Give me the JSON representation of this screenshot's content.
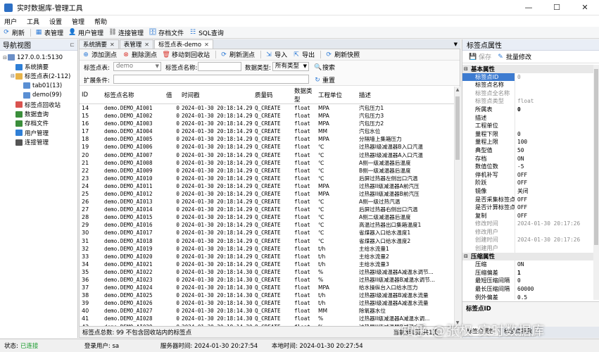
{
  "window": {
    "title": "实时数据库-管理工具",
    "controls": [
      "—",
      "☐",
      "✕"
    ]
  },
  "menu": [
    "用户",
    "工具",
    "设置",
    "管理",
    "帮助"
  ],
  "toolbar": [
    {
      "label": "刷新",
      "icon": "refresh-icon"
    },
    {
      "label": "表管理",
      "icon": "table-icon"
    },
    {
      "label": "用户管理",
      "icon": "user-icon"
    },
    {
      "label": "连接管理",
      "icon": "connection-icon"
    },
    {
      "label": "存档文件",
      "icon": "archive-icon"
    },
    {
      "label": "SQL查询",
      "icon": "sql-icon"
    }
  ],
  "nav": {
    "title": "导航视图",
    "items": [
      {
        "label": "127.0.0.1:5130",
        "indent": 0,
        "twisty": "⊟",
        "icon": "server-icon",
        "color": "#6b8fc7"
      },
      {
        "label": "系统摘要",
        "indent": 1,
        "twisty": "",
        "icon": "summary-icon",
        "color": "#2f7fd6"
      },
      {
        "label": "标签点表(2-112)",
        "indent": 1,
        "twisty": "⊟",
        "icon": "folder-icon",
        "color": "#e8b44a"
      },
      {
        "label": "tab01(13)",
        "indent": 2,
        "twisty": "",
        "icon": "table-icon",
        "color": "#5a8fd3"
      },
      {
        "label": "demo(99)",
        "indent": 2,
        "twisty": "",
        "icon": "table-icon",
        "color": "#5a8fd3"
      },
      {
        "label": "标签点回收站",
        "indent": 1,
        "twisty": "",
        "icon": "recycle-icon",
        "color": "#d9534f"
      },
      {
        "label": "数据查询",
        "indent": 1,
        "twisty": "",
        "icon": "query-icon",
        "color": "#3b8e3b"
      },
      {
        "label": "存档文件",
        "indent": 1,
        "twisty": "",
        "icon": "archive-icon",
        "color": "#3b8e3b"
      },
      {
        "label": "用户管理",
        "indent": 1,
        "twisty": "",
        "icon": "user-icon",
        "color": "#2f7fd6"
      },
      {
        "label": "连接管理",
        "indent": 1,
        "twisty": "",
        "icon": "connection-icon",
        "color": "#555555"
      }
    ]
  },
  "tabs": [
    {
      "label": "系统摘要",
      "active": false
    },
    {
      "label": "表管理",
      "active": false
    },
    {
      "label": "标签点表-demo",
      "active": true
    }
  ],
  "inner_toolbar": [
    {
      "label": "添加测点",
      "icon": "add-icon",
      "color": "#2e7bd6"
    },
    {
      "label": "删除测点",
      "icon": "delete-icon",
      "color": "#d9342b"
    },
    {
      "label": "移动到回收站",
      "icon": "recycle-icon",
      "color": "#d9342b"
    },
    {
      "label": "刷新测点",
      "icon": "refresh-icon",
      "color": "#2e7bd6"
    },
    {
      "label": "导入",
      "icon": "import-icon",
      "color": "#2e7bd6"
    },
    {
      "label": "导出",
      "icon": "export-icon",
      "color": "#2e7bd6"
    },
    {
      "label": "刷新快照",
      "icon": "refresh-icon",
      "color": "#2e7bd6"
    }
  ],
  "filters": {
    "table_label": "标签点表:",
    "table_value": "demo",
    "name_label": "标签点名称:",
    "name_value": "",
    "type_label": "数据类型:",
    "type_value": "所有类型",
    "ext_label": "扩展条件:",
    "ext_value": "",
    "search": "搜索",
    "reset": "重置"
  },
  "grid": {
    "columns": [
      "ID",
      "标签点名称",
      "值",
      "时间戳",
      "质量码",
      "数据类型",
      "工程单位",
      "描述"
    ],
    "rows": [
      [
        "14",
        "demo.DEMO_AI001",
        "0",
        "2024-01-30 20:18:14.296",
        "Q_CREATE",
        "float",
        "MPA",
        "汽包压力1"
      ],
      [
        "15",
        "demo.DEMO_AI002",
        "0",
        "2024-01-30 20:18:14.296",
        "Q_CREATE",
        "float",
        "MPA",
        "汽包压力3"
      ],
      [
        "16",
        "demo.DEMO_AI003",
        "0",
        "2024-01-30 20:18:14.296",
        "Q_CREATE",
        "float",
        "MPA",
        "汽包压力2"
      ],
      [
        "17",
        "demo.DEMO_AI004",
        "0",
        "2024-01-30 20:18:14.296",
        "Q_CREATE",
        "float",
        "MM",
        "汽包水位"
      ],
      [
        "18",
        "demo.DEMO_AI005",
        "0",
        "2024-01-30 20:18:14.297",
        "Q_CREATE",
        "float",
        "MPA",
        "分隔墙上集箱压力"
      ],
      [
        "19",
        "demo.DEMO_AI006",
        "0",
        "2024-01-30 20:18:14.297",
        "Q_CREATE",
        "float",
        "℃",
        "过热器I级减温器B入口汽温"
      ],
      [
        "20",
        "demo.DEMO_AI007",
        "0",
        "2024-01-30 20:18:14.297",
        "Q_CREATE",
        "float",
        "℃",
        "过热器I级减温器A入口汽温"
      ],
      [
        "21",
        "demo.DEMO_AI008",
        "0",
        "2024-01-30 20:18:14.297",
        "Q_CREATE",
        "float",
        "℃",
        "A侧一级减温器后温度"
      ],
      [
        "22",
        "demo.DEMO_AI009",
        "0",
        "2024-01-30 20:18:14.297",
        "Q_CREATE",
        "float",
        "℃",
        "B侧一级减温器后温度"
      ],
      [
        "23",
        "demo.DEMO_AI010",
        "0",
        "2024-01-30 20:18:14.297",
        "Q_CREATE",
        "float",
        "℃",
        "后屏过热器左侧出口汽温"
      ],
      [
        "24",
        "demo.DEMO_AI011",
        "0",
        "2024-01-30 20:18:14.298",
        "Q_CREATE",
        "float",
        "MPA",
        "过热器II级减温器A前汽压"
      ],
      [
        "25",
        "demo.DEMO_AI012",
        "0",
        "2024-01-30 20:18:14.298",
        "Q_CREATE",
        "float",
        "MPA",
        "过热器II级减温器B前汽压"
      ],
      [
        "26",
        "demo.DEMO_AI013",
        "0",
        "2024-01-30 20:18:14.298",
        "Q_CREATE",
        "float",
        "℃",
        "A侧一级过热汽温"
      ],
      [
        "27",
        "demo.DEMO_AI014",
        "0",
        "2024-01-30 20:18:14.298",
        "Q_CREATE",
        "float",
        "℃",
        "后屏过热器右侧出口汽温"
      ],
      [
        "28",
        "demo.DEMO_AI015",
        "0",
        "2024-01-30 20:18:14.299",
        "Q_CREATE",
        "float",
        "℃",
        "A侧二级减温器后温度"
      ],
      [
        "29",
        "demo.DEMO_AI016",
        "0",
        "2024-01-30 20:18:14.299",
        "Q_CREATE",
        "float",
        "℃",
        "高温过热器出口集箱温度1"
      ],
      [
        "30",
        "demo.DEMO_AI017",
        "0",
        "2024-01-30 20:18:14.299",
        "Q_CREATE",
        "float",
        "℃",
        "省煤器入口给水温度1"
      ],
      [
        "31",
        "demo.DEMO_AI018",
        "0",
        "2024-01-30 20:18:14.299",
        "Q_CREATE",
        "float",
        "℃",
        "省煤器入口给水温度2"
      ],
      [
        "32",
        "demo.DEMO_AI019",
        "0",
        "2024-01-30 20:18:14.299",
        "Q_CREATE",
        "float",
        "t/h",
        "主给水流量1"
      ],
      [
        "33",
        "demo.DEMO_AI020",
        "0",
        "2024-01-30 20:18:14.299",
        "Q_CREATE",
        "float",
        "t/h",
        "主给水流量2"
      ],
      [
        "34",
        "demo.DEMO_AI021",
        "0",
        "2024-01-30 20:18:14.299",
        "Q_CREATE",
        "float",
        "t/h",
        "主给水流量3"
      ],
      [
        "35",
        "demo.DEMO_AI022",
        "0",
        "2024-01-30 20:18:14.300",
        "Q_CREATE",
        "float",
        "%",
        "过热器I级减温器A减温水调节..."
      ],
      [
        "36",
        "demo.DEMO_AI023",
        "0",
        "2024-01-30 20:18:14.300",
        "Q_CREATE",
        "float",
        "%",
        "过热器II级减温器B减温水调节..."
      ],
      [
        "37",
        "demo.DEMO_AI024",
        "0",
        "2024-01-30 20:18:14.300",
        "Q_CREATE",
        "float",
        "MPA",
        "给水操纵台入口给水压力"
      ],
      [
        "38",
        "demo.DEMO_AI025",
        "0",
        "2024-01-30 20:18:14.300",
        "Q_CREATE",
        "float",
        "t/h",
        "过热器I级减温器B减温水流量"
      ],
      [
        "39",
        "demo.DEMO_AI026",
        "0",
        "2024-01-30 20:18:14.300",
        "Q_CREATE",
        "float",
        "t/h",
        "过热器I级减温器A减温水流量"
      ],
      [
        "40",
        "demo.DEMO_AI027",
        "0",
        "2024-01-30 20:18:14.300",
        "Q_CREATE",
        "float",
        "MM",
        "除氧器水位"
      ],
      [
        "41",
        "demo.DEMO_AI028",
        "0",
        "2024-01-30 20:18:14.301",
        "Q_CREATE",
        "float",
        "%",
        "过热器II级减温器A减温水调..."
      ],
      [
        "42",
        "demo.DEMO_AI029",
        "0",
        "2024-01-30 20:18:14.301",
        "Q_CREATE",
        "float",
        "%",
        "过热器II级减温器B减温水调..."
      ],
      [
        "43",
        "demo.DEMO_AI030",
        "0",
        "2024-01-30 20:18:14.301",
        "Q_CREATE",
        "float",
        "t/h",
        "过热器II级减温器A减温水流量"
      ]
    ]
  },
  "grid_status": {
    "total": "标签点总数: 99  不包含回收站内的标签点",
    "pager": "当前第1页,共1页"
  },
  "props": {
    "title": "标签点属性",
    "save": "保存",
    "batch": "批量修改",
    "categories": [
      {
        "name": "基本属性",
        "rows": [
          {
            "k": "标签点ID",
            "v": "0",
            "ro": true
          },
          {
            "k": "标签点名称",
            "v": "",
            "ro": false
          },
          {
            "k": "标签点全名称",
            "v": "",
            "ro": true
          },
          {
            "k": "标签点类型",
            "v": "float",
            "ro": true
          },
          {
            "k": "所属表",
            "v": "0",
            "ro": false,
            "bold": true
          },
          {
            "k": "描述",
            "v": "",
            "ro": false
          },
          {
            "k": "工程单位",
            "v": "",
            "ro": false
          },
          {
            "k": "量程下限",
            "v": "0",
            "ro": false
          },
          {
            "k": "量程上限",
            "v": "100",
            "ro": false
          },
          {
            "k": "典型值",
            "v": "50",
            "ro": false
          },
          {
            "k": "存档",
            "v": "ON",
            "ro": false
          },
          {
            "k": "数值位数",
            "v": "-5",
            "ro": false
          },
          {
            "k": "停机补写",
            "v": "OFF",
            "ro": false
          },
          {
            "k": "阶跃",
            "v": "OFF",
            "ro": false
          },
          {
            "k": "镜像",
            "v": "关闭",
            "ro": false
          },
          {
            "k": "是否采集标签点",
            "v": "OFF",
            "ro": false
          },
          {
            "k": "是否计算标签点",
            "v": "OFF",
            "ro": false
          },
          {
            "k": "复制",
            "v": "OFF",
            "ro": false
          },
          {
            "k": "修改时间",
            "v": "2024-01-30 20:17:26",
            "ro": true
          },
          {
            "k": "修改用户",
            "v": "",
            "ro": true
          },
          {
            "k": "创建时间",
            "v": "2024-01-30 20:17:26",
            "ro": true
          },
          {
            "k": "创建用户",
            "v": "",
            "ro": true
          }
        ]
      },
      {
        "name": "压缩属性",
        "rows": [
          {
            "k": "压缩",
            "v": "ON",
            "ro": false
          },
          {
            "k": "压缩偏差",
            "v": "1",
            "ro": false,
            "bold": true
          },
          {
            "k": "最短压缩间隔",
            "v": "0",
            "ro": false
          },
          {
            "k": "最长压缩间隔",
            "v": "60000",
            "ro": false
          },
          {
            "k": "例外偏差",
            "v": "0.5",
            "ro": false
          }
        ]
      }
    ],
    "desc_title": "标签点ID",
    "tabs": [
      "标签点属性",
      "标签点参数"
    ]
  },
  "statusbar": {
    "state_label": "状态:",
    "state_value": "已连接",
    "user": "登录用户:  sa",
    "server_time": "服务器时间:  2024-01-30 20:27:54",
    "local_time": "本地时间:  2024-01-30 20:27:54"
  },
  "watermark": "知乎 @张权-实时数据库"
}
